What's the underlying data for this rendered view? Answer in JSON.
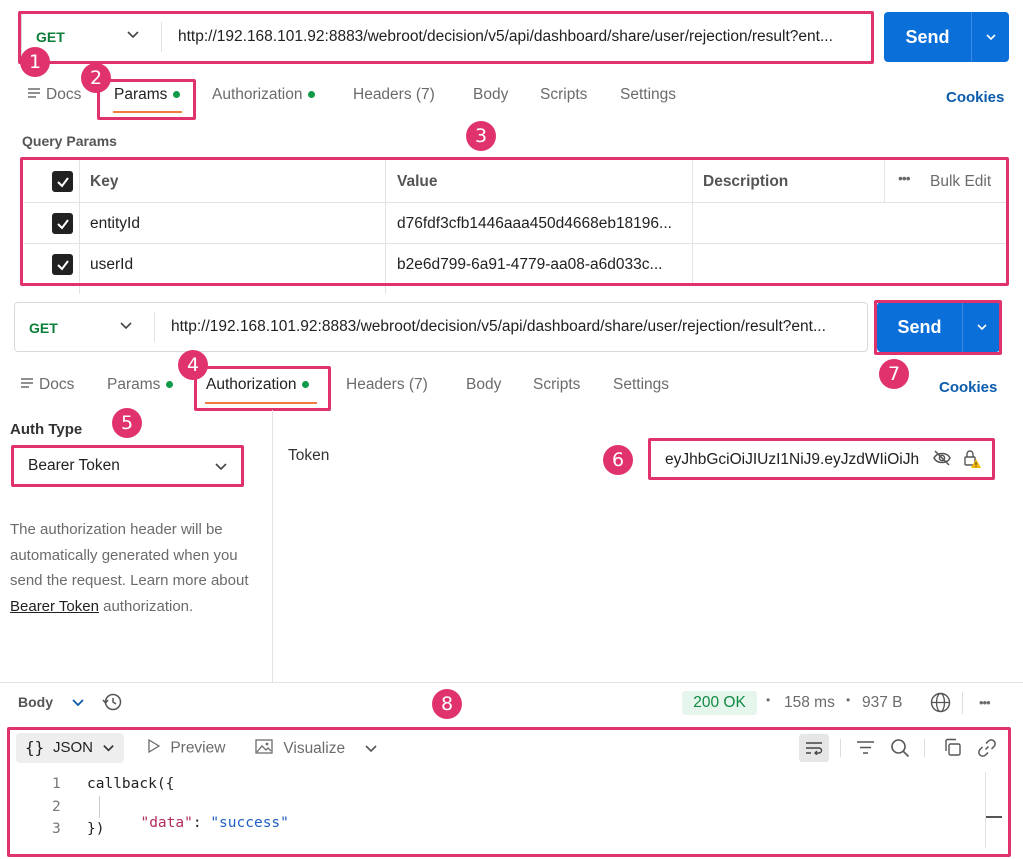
{
  "request1": {
    "method": "GET",
    "url": "http://192.168.101.92:8883/webroot/decision/v5/api/dashboard/share/user/rejection/result?ent...",
    "send_label": "Send",
    "tabs": [
      {
        "label": "Docs"
      },
      {
        "label": "Params"
      },
      {
        "label": "Authorization"
      },
      {
        "label": "Headers (7)"
      },
      {
        "label": "Body"
      },
      {
        "label": "Scripts"
      },
      {
        "label": "Settings"
      }
    ],
    "cookies_label": "Cookies"
  },
  "query_params": {
    "section_title": "Query Params",
    "headers": {
      "key": "Key",
      "value": "Value",
      "description": "Description",
      "bulk_edit": "Bulk Edit"
    },
    "rows": [
      {
        "key": "entityId",
        "value": "d76fdf3cfb1446aaa450d4668eb18196...",
        "description": ""
      },
      {
        "key": "userId",
        "value": "b2e6d799-6a91-4779-aa08-a6d033c...",
        "description": ""
      }
    ]
  },
  "request2": {
    "method": "GET",
    "url": "http://192.168.101.92:8883/webroot/decision/v5/api/dashboard/share/user/rejection/result?ent...",
    "send_label": "Send",
    "tabs": [
      {
        "label": "Docs"
      },
      {
        "label": "Params"
      },
      {
        "label": "Authorization"
      },
      {
        "label": "Headers (7)"
      },
      {
        "label": "Body"
      },
      {
        "label": "Scripts"
      },
      {
        "label": "Settings"
      }
    ],
    "cookies_label": "Cookies"
  },
  "auth": {
    "auth_type_label": "Auth Type",
    "auth_type_value": "Bearer Token",
    "description_before": "The authorization header will be automatically generated when you send the request. Learn more about ",
    "description_link": "Bearer Token",
    "description_after": " authorization.",
    "token_label": "Token",
    "token_value": "eyJhbGciOiJIUzI1NiJ9.eyJzdWIiOiJh"
  },
  "response": {
    "body_label": "Body",
    "status": "200 OK",
    "time": "158 ms",
    "size": "937 B",
    "format": "JSON",
    "preview_label": "Preview",
    "visualize_label": "Visualize",
    "code_lines": [
      {
        "num": "1",
        "text": "callback({"
      },
      {
        "num": "2",
        "key": "\"data\"",
        "sep": ": ",
        "val": "\"success\""
      },
      {
        "num": "3",
        "text": "})"
      }
    ]
  },
  "callouts": [
    "1",
    "2",
    "3",
    "4",
    "5",
    "6",
    "7",
    "8"
  ],
  "colors": {
    "accent": "#e0336d",
    "send": "#0b6fd9",
    "method": "#0b7f3a",
    "ok": "#0f9b4a",
    "link": "#0b5cad",
    "json_key": "#b02c5e",
    "json_string": "#1f5fc4"
  }
}
